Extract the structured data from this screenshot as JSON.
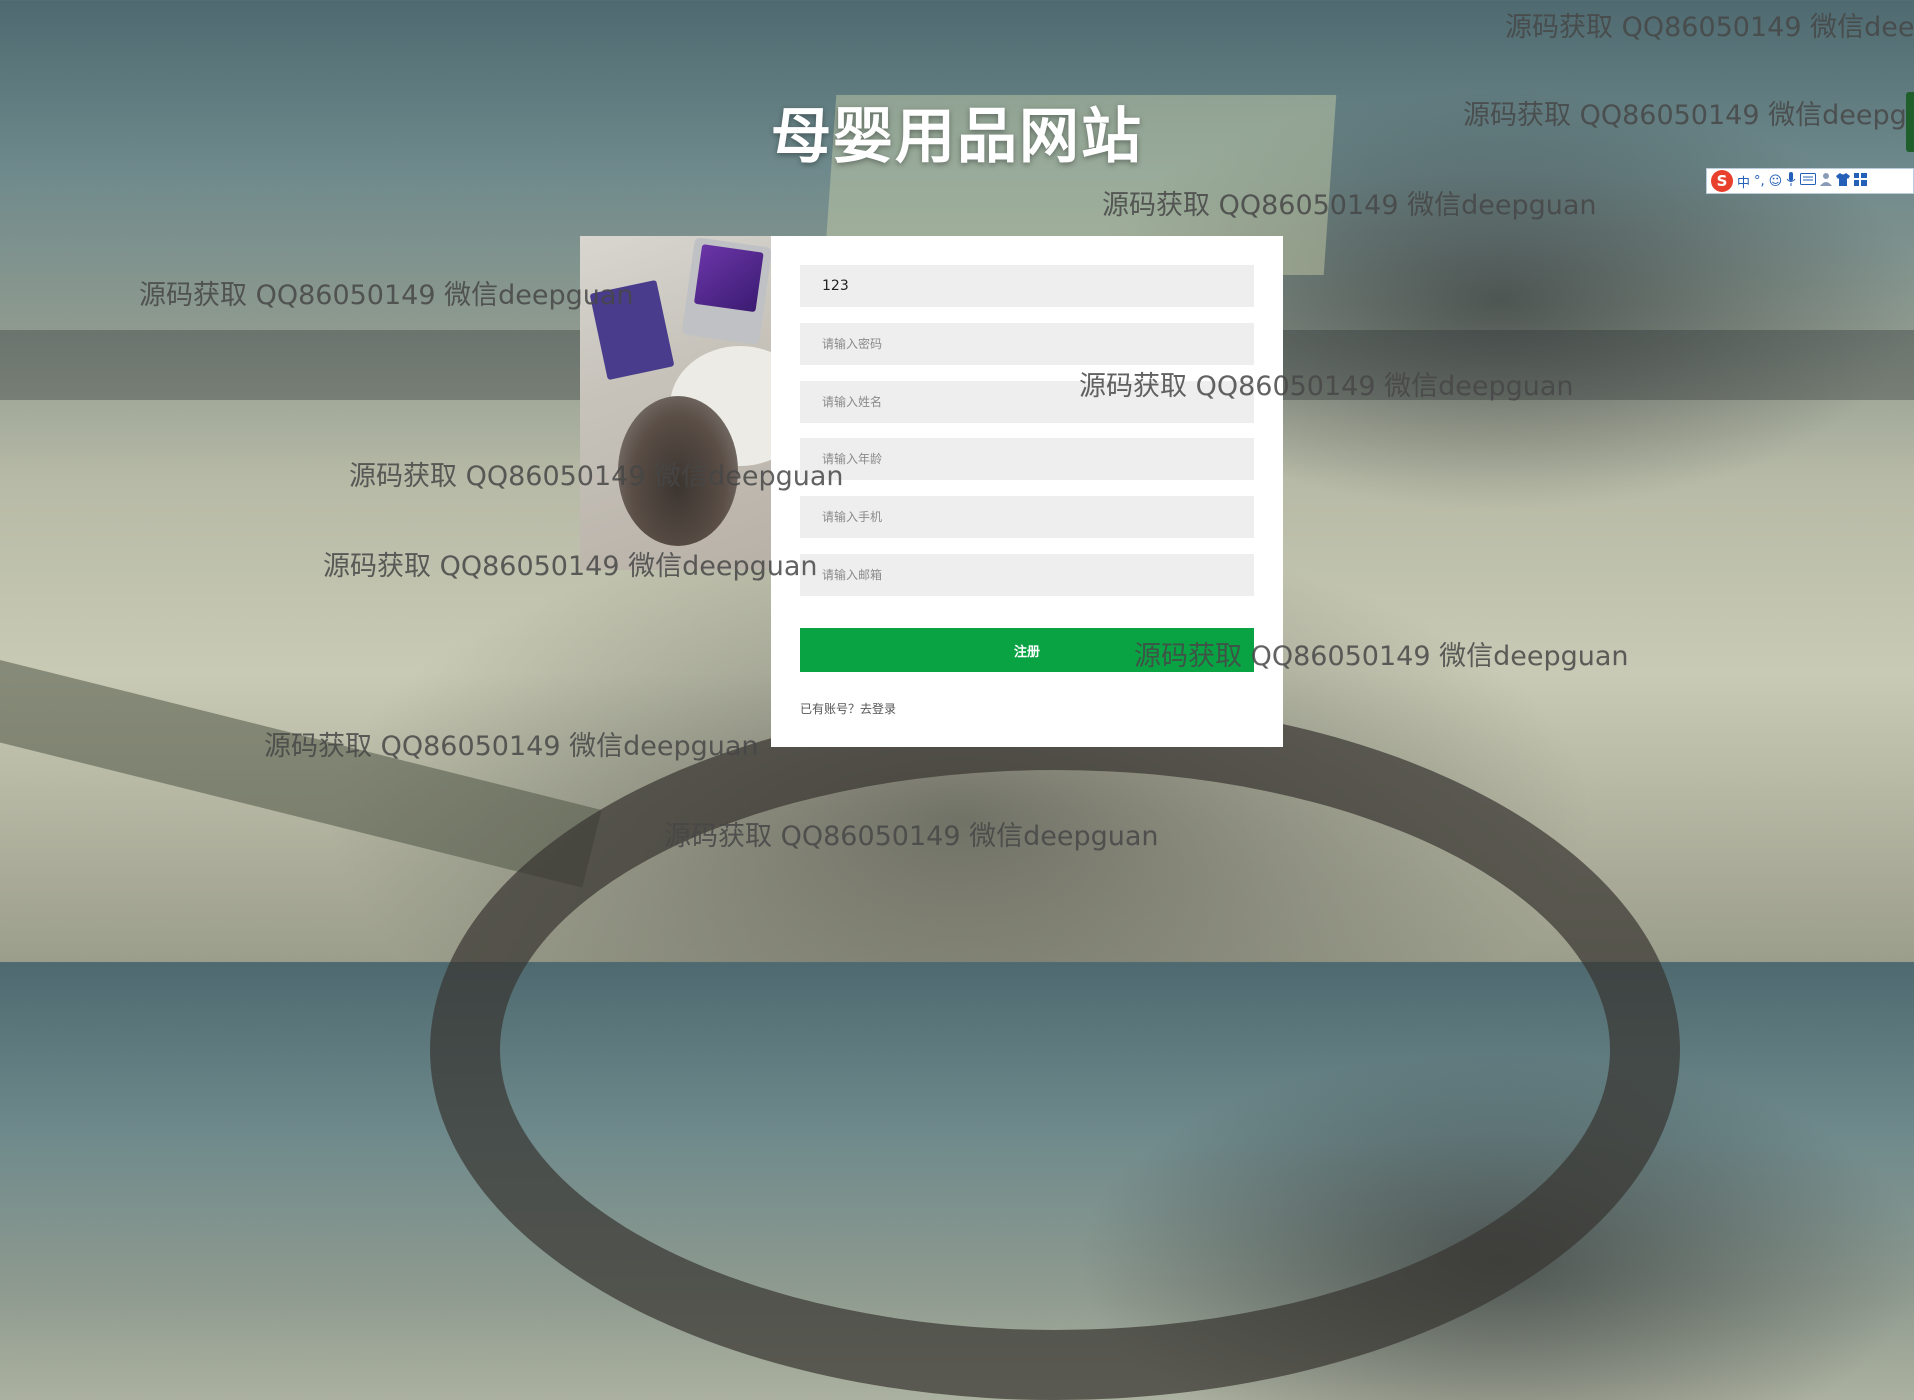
{
  "site": {
    "title": "母婴用品网站"
  },
  "form": {
    "username_value": "123",
    "password_placeholder": "请输入密码",
    "name_placeholder": "请输入姓名",
    "age_placeholder": "请输入年龄",
    "phone_placeholder": "请输入手机",
    "email_placeholder": "请输入邮箱",
    "submit_label": "注册",
    "login_link_label": "已有账号？去登录"
  },
  "watermark": {
    "text": "源码获取 QQ86050149 微信deepguan"
  },
  "ime_toolbar": {
    "logo": "S",
    "mode": "中",
    "items": [
      "°,",
      "☺",
      "mic-icon",
      "keyboard-icon",
      "user-icon",
      "shirt-icon",
      "grid-icon"
    ]
  },
  "colors": {
    "accent_green": "#0aa344",
    "panel_white": "#ffffff",
    "input_bg": "#eeeeee"
  }
}
